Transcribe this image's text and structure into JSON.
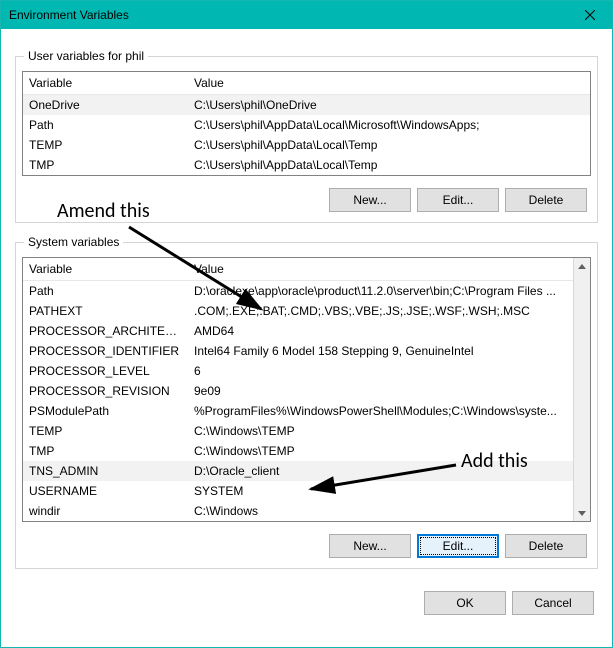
{
  "window": {
    "title": "Environment Variables"
  },
  "user_section": {
    "legend": "User variables for phil",
    "headers": {
      "variable": "Variable",
      "value": "Value"
    },
    "rows": [
      {
        "name": "OneDrive",
        "value": "C:\\Users\\phil\\OneDrive"
      },
      {
        "name": "Path",
        "value": "C:\\Users\\phil\\AppData\\Local\\Microsoft\\WindowsApps;"
      },
      {
        "name": "TEMP",
        "value": "C:\\Users\\phil\\AppData\\Local\\Temp"
      },
      {
        "name": "TMP",
        "value": "C:\\Users\\phil\\AppData\\Local\\Temp"
      }
    ],
    "buttons": {
      "new": "New...",
      "edit": "Edit...",
      "delete": "Delete"
    }
  },
  "system_section": {
    "legend": "System variables",
    "headers": {
      "variable": "Variable",
      "value": "Value"
    },
    "rows": [
      {
        "name": "Path",
        "value": "D:\\oraclexe\\app\\oracle\\product\\11.2.0\\server\\bin;C:\\Program Files ..."
      },
      {
        "name": "PATHEXT",
        "value": ".COM;.EXE;.BAT;.CMD;.VBS;.VBE;.JS;.JSE;.WSF;.WSH;.MSC"
      },
      {
        "name": "PROCESSOR_ARCHITECTURE",
        "value": "AMD64"
      },
      {
        "name": "PROCESSOR_IDENTIFIER",
        "value": "Intel64 Family 6 Model 158 Stepping 9, GenuineIntel"
      },
      {
        "name": "PROCESSOR_LEVEL",
        "value": "6"
      },
      {
        "name": "PROCESSOR_REVISION",
        "value": "9e09"
      },
      {
        "name": "PSModulePath",
        "value": "%ProgramFiles%\\WindowsPowerShell\\Modules;C:\\Windows\\syste..."
      },
      {
        "name": "TEMP",
        "value": "C:\\Windows\\TEMP"
      },
      {
        "name": "TMP",
        "value": "C:\\Windows\\TEMP"
      },
      {
        "name": "TNS_ADMIN",
        "value": "D:\\Oracle_client"
      },
      {
        "name": "USERNAME",
        "value": "SYSTEM"
      },
      {
        "name": "windir",
        "value": "C:\\Windows"
      }
    ],
    "buttons": {
      "new": "New...",
      "edit": "Edit...",
      "delete": "Delete"
    }
  },
  "dialog": {
    "ok": "OK",
    "cancel": "Cancel"
  },
  "annotations": {
    "amend": "Amend this",
    "add": "Add this"
  }
}
